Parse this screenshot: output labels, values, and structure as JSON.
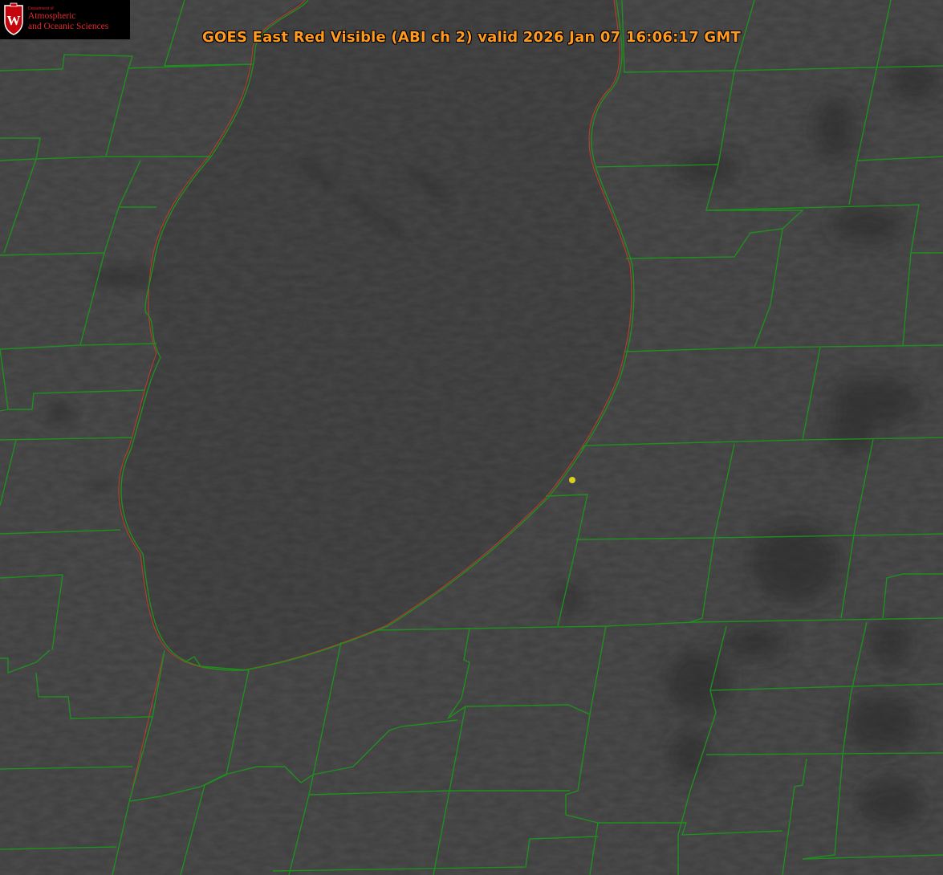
{
  "title": "GOES East Red Visible (ABI ch 2) valid 2026 Jan 07 16:06:17 GMT",
  "logo": {
    "dept": "Department of",
    "line1": "Atmospheric",
    "line2": "and Oceanic Sciences"
  },
  "colors": {
    "boundary": "#1f8f1f",
    "shoreline": "#c23a2a",
    "marker": "#d8d020",
    "title": "#ff9a1e",
    "logo_text": "#e02a2a"
  }
}
